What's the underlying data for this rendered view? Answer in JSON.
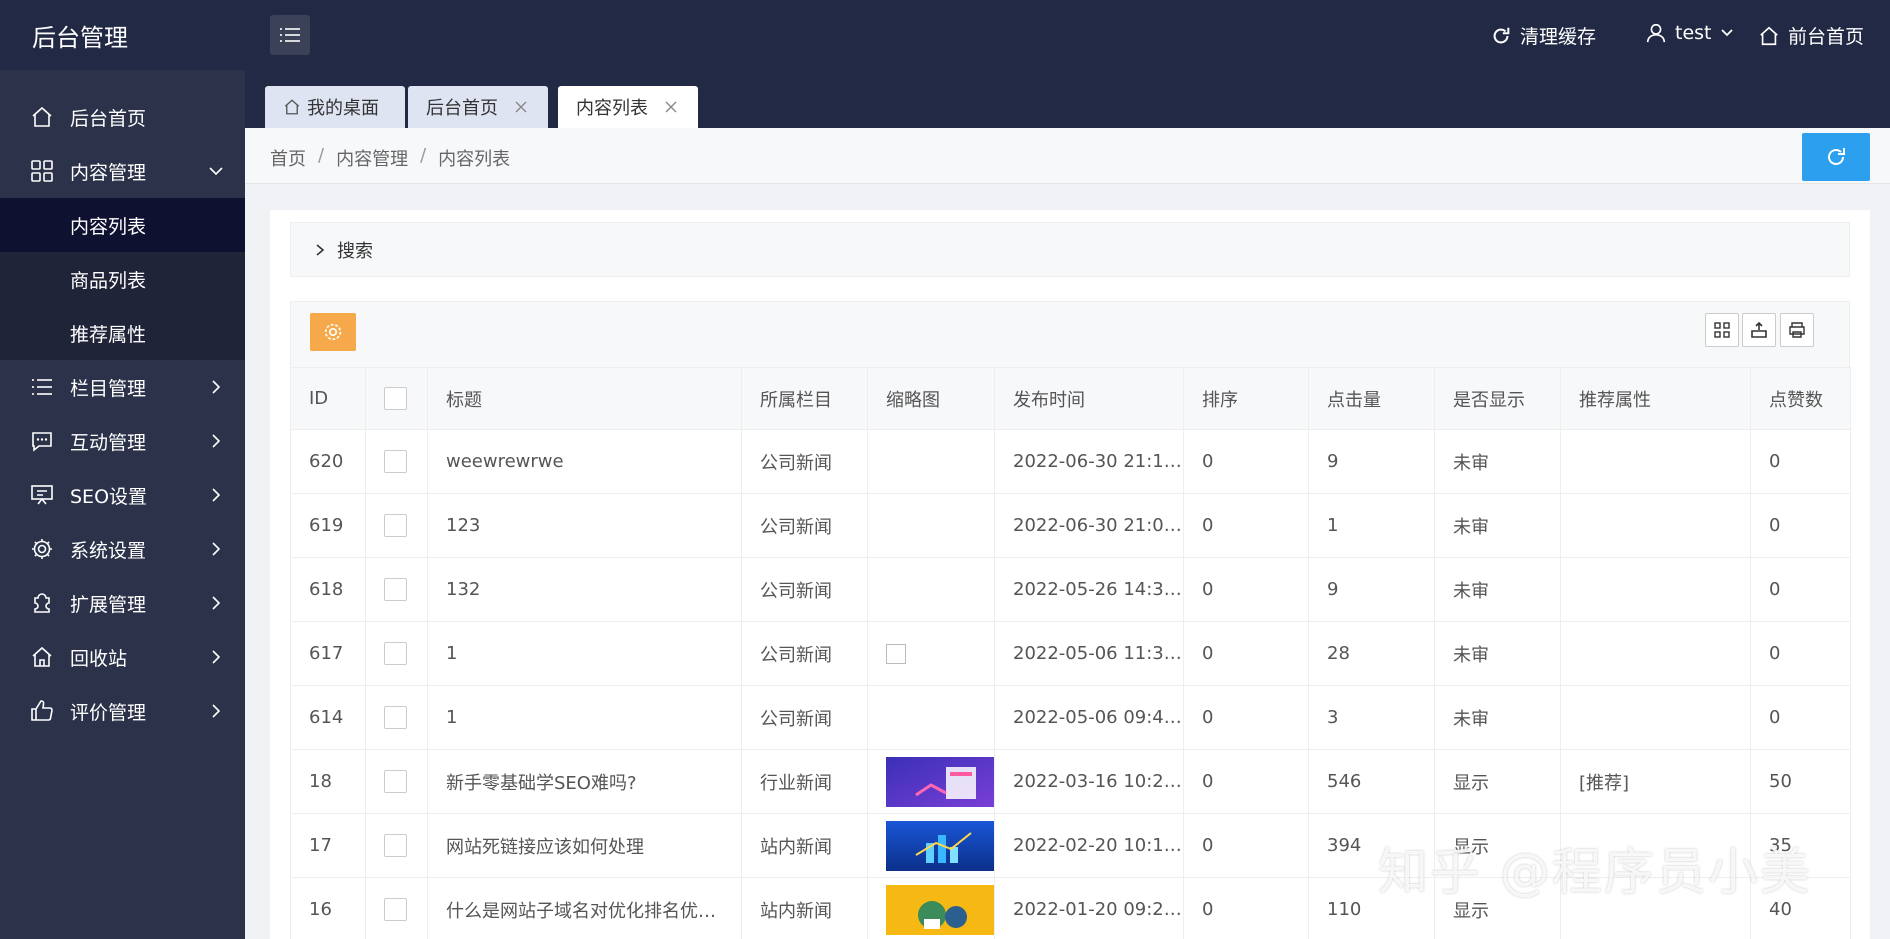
{
  "header": {
    "title": "后台管理",
    "clear_cache": "清理缓存",
    "user": "test",
    "frontend_home": "前台首页"
  },
  "sidebar": {
    "items": [
      {
        "label": "后台首页"
      },
      {
        "label": "内容管理"
      },
      {
        "label": "内容列表"
      },
      {
        "label": "商品列表"
      },
      {
        "label": "推荐属性"
      },
      {
        "label": "栏目管理"
      },
      {
        "label": "互动管理"
      },
      {
        "label": "SEO设置"
      },
      {
        "label": "系统设置"
      },
      {
        "label": "扩展管理"
      },
      {
        "label": "回收站"
      },
      {
        "label": "评价管理"
      }
    ]
  },
  "tabs": [
    {
      "label": "我的桌面"
    },
    {
      "label": "后台首页"
    },
    {
      "label": "内容列表"
    }
  ],
  "breadcrumb": [
    "首页",
    "内容管理",
    "内容列表"
  ],
  "search": {
    "label": "搜索"
  },
  "table": {
    "headers": [
      "ID",
      "",
      "标题",
      "所属栏目",
      "缩略图",
      "发布时间",
      "排序",
      "点击量",
      "是否显示",
      "推荐属性",
      "点赞数"
    ],
    "rows": [
      {
        "id": "620",
        "title": "weewrewrwe",
        "column": "公司新闻",
        "time": "2022-06-30 21:1…",
        "sort": "0",
        "clicks": "9",
        "show": "未审",
        "rec": "",
        "likes": "0"
      },
      {
        "id": "619",
        "title": "123",
        "column": "公司新闻",
        "time": "2022-06-30 21:0…",
        "sort": "0",
        "clicks": "1",
        "show": "未审",
        "rec": "",
        "likes": "0"
      },
      {
        "id": "618",
        "title": "132",
        "column": "公司新闻",
        "time": "2022-05-26 14:3…",
        "sort": "0",
        "clicks": "9",
        "show": "未审",
        "rec": "",
        "likes": "0"
      },
      {
        "id": "617",
        "title": "1",
        "column": "公司新闻",
        "time": "2022-05-06 11:3…",
        "sort": "0",
        "clicks": "28",
        "show": "未审",
        "rec": "",
        "likes": "0"
      },
      {
        "id": "614",
        "title": "1",
        "column": "公司新闻",
        "time": "2022-05-06 09:4…",
        "sort": "0",
        "clicks": "3",
        "show": "未审",
        "rec": "",
        "likes": "0"
      },
      {
        "id": "18",
        "title": "新手零基础学SEO难吗?",
        "column": "行业新闻",
        "time": "2022-03-16 10:2…",
        "sort": "0",
        "clicks": "546",
        "show": "显示",
        "rec": "[推荐]",
        "likes": "50"
      },
      {
        "id": "17",
        "title": "网站死链接应该如何处理",
        "column": "站内新闻",
        "time": "2022-02-20 10:1…",
        "sort": "0",
        "clicks": "394",
        "show": "显示",
        "rec": "",
        "likes": "35"
      },
      {
        "id": "16",
        "title": "什么是网站子域名对优化排名优…",
        "column": "站内新闻",
        "time": "2022-01-20 09:2…",
        "sort": "0",
        "clicks": "110",
        "show": "显示",
        "rec": "",
        "likes": "40"
      }
    ]
  },
  "watermark": "知乎 @程序员小美",
  "colors": {
    "header_bg": "#222944",
    "sidebar_bg": "#2b3249",
    "active_item_bg": "#0e1130",
    "refresh_btn": "#2d9fef",
    "gear_btn": "#f5a94a"
  }
}
